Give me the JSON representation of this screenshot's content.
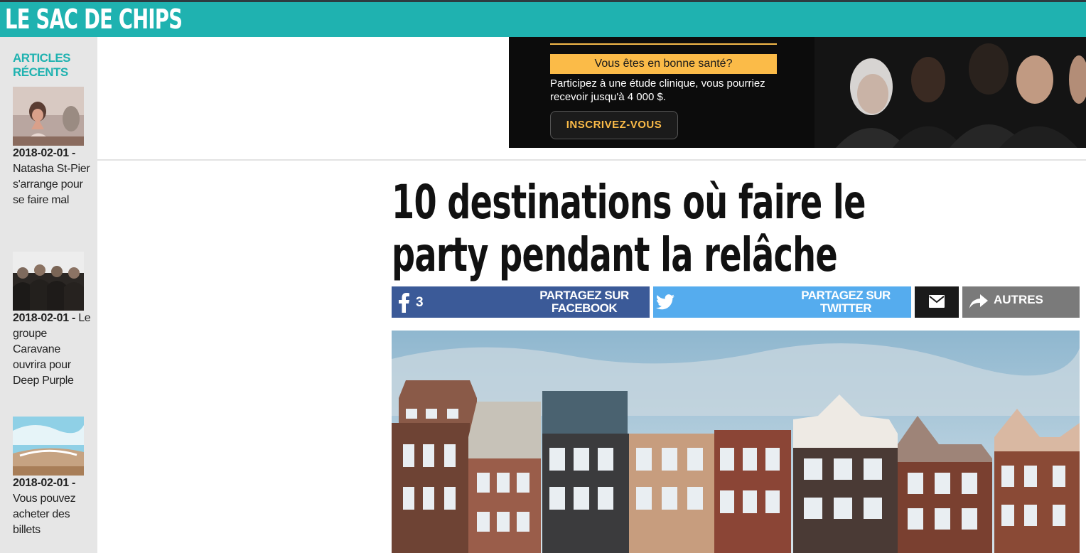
{
  "header": {
    "site_title": "LE SAC DE CHIPS"
  },
  "sidebar": {
    "heading": "ARTICLES RÉCENTS",
    "items": [
      {
        "date": "2018-02-01 -",
        "title": "Natasha St-Pier s'arrange pour se faire mal"
      },
      {
        "date": "2018-02-01 -",
        "title": "Le groupe Caravane ouvrira pour Deep Purple"
      },
      {
        "date": "2018-02-01 -",
        "title": "Vous pouvez acheter des billets"
      }
    ]
  },
  "ad": {
    "headline": "Vous êtes en bonne santé?",
    "body": "Participez à une étude clinique, vous pourriez recevoir jusqu'à 4 000 $.",
    "cta": "INSCRIVEZ-VOUS"
  },
  "article": {
    "title": "10 destinations où faire le party pendant la relâche",
    "share": {
      "facebook_count": "3",
      "facebook_label": "PARTAGEZ SUR FACEBOOK",
      "twitter_label": "PARTAGEZ SUR TWITTER",
      "more_label": "AUTRES"
    }
  },
  "colors": {
    "brand": "#1fb2b0",
    "facebook": "#3b5a98",
    "twitter": "#55acee",
    "ad_accent": "#fbbb48"
  },
  "icons": [
    "facebook-icon",
    "twitter-icon",
    "mail-icon",
    "share-arrow-icon"
  ]
}
